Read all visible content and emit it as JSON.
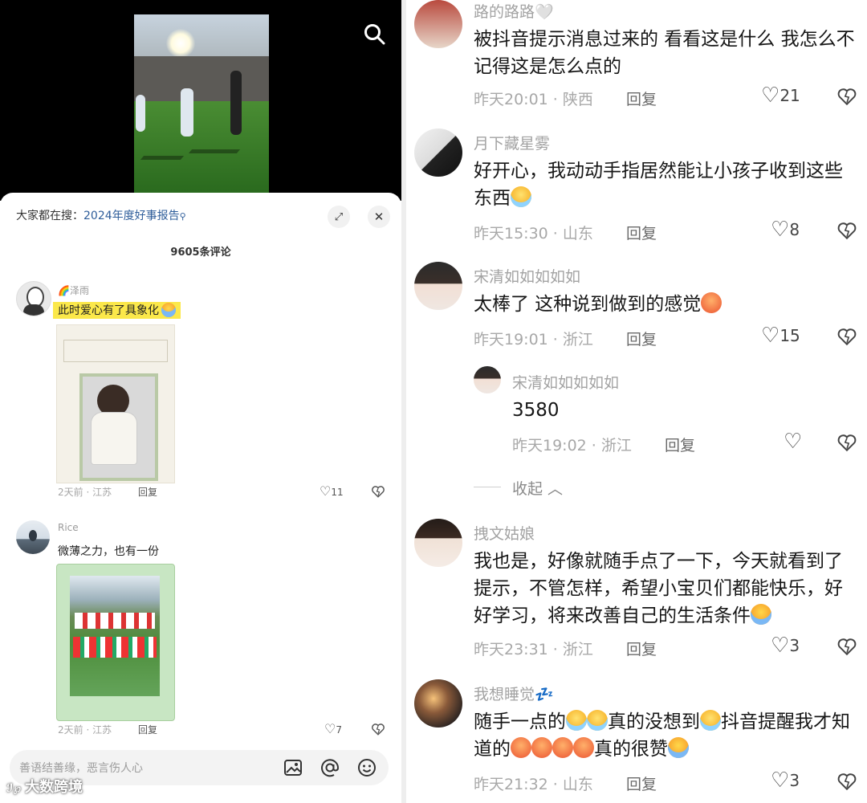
{
  "left": {
    "search_hint_prefix": "大家都在搜：",
    "search_hint_keyword": "2024年度好事报告",
    "comment_count": "9605条评论",
    "comments": [
      {
        "user": "泽雨",
        "text": "此时爱心有了具象化",
        "meta": "2天前 · 江苏",
        "reply": "回复",
        "likes": "11"
      },
      {
        "user": "Rice",
        "text": "微薄之力，也有一份",
        "meta": "2天前 · 江苏",
        "reply": "回复",
        "likes": "7"
      }
    ],
    "input_placeholder": "善语结善缘，恶言伤人心",
    "watermark": "大数跨境"
  },
  "right": {
    "comments": [
      {
        "user": "路的路路🤍",
        "text": "被抖音提示消息过来的  看看这是什么  我怎么不记得这是怎么点的",
        "meta": "昨天20:01 · 陕西",
        "reply": "回复",
        "likes": "21"
      },
      {
        "user": "月下藏星雾",
        "text": "好开心，我动动手指居然能让小孩子收到这些东西",
        "meta": "昨天15:30 · 山东",
        "reply": "回复",
        "likes": "8"
      },
      {
        "user": "宋清如如如如如",
        "text": "太棒了  这种说到做到的感觉",
        "meta": "昨天19:01 · 浙江",
        "reply": "回复",
        "likes": "15"
      },
      {
        "user": "拽文姑娘",
        "text": "我也是，好像就随手点了一下，今天就看到了提示，不管怎样，希望小宝贝们都能快乐，好好学习，将来改善自己的生活条件",
        "meta": "昨天23:31 · 浙江",
        "reply": "回复",
        "likes": "3"
      },
      {
        "user": "我想睡觉💤",
        "text_a": "随手一点的",
        "text_b": "真的没想到",
        "text_c": "抖音提醒我才知道的",
        "text_d": "真的很赞",
        "meta": "昨天21:32 · 山东",
        "reply": "回复",
        "likes": "3"
      }
    ],
    "sub_reply": {
      "user": "宋清如如如如如",
      "text": "3580",
      "meta": "昨天19:02 · 浙江",
      "reply": "回复"
    },
    "collapse_label": "收起"
  },
  "colors": {
    "keyword": "#2e5d9a",
    "highlight": "#fbe84a"
  }
}
